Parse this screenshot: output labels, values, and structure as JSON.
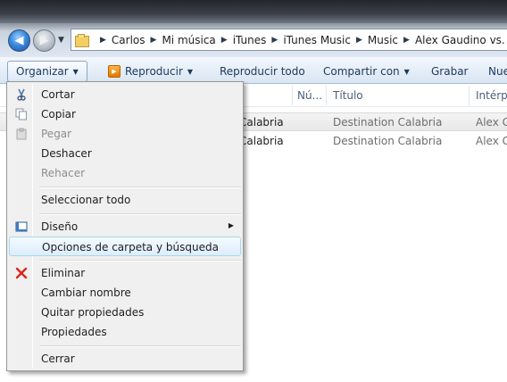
{
  "address": {
    "crumbs": [
      "Carlos",
      "Mi música",
      "iTunes",
      "iTunes Music",
      "Music",
      "Alex Gaudino vs. Crys"
    ]
  },
  "toolbar": {
    "organize": "Organizar",
    "play": "Reproducir",
    "play_all": "Reproducir todo",
    "share": "Compartir con",
    "burn": "Grabar",
    "new": "Nue"
  },
  "columns": {
    "num": "Nú...",
    "title": "Título",
    "artist": "Intérpr"
  },
  "files": [
    {
      "name": "Calabria",
      "title": "Destination Calabria",
      "artist": "Alex Ga"
    },
    {
      "name": "Calabria",
      "title": "Destination Calabria",
      "artist": "Alex Ga"
    }
  ],
  "menu": {
    "cut": "Cortar",
    "copy": "Copiar",
    "paste": "Pegar",
    "undo": "Deshacer",
    "redo": "Rehacer",
    "select_all": "Seleccionar todo",
    "layout": "Diseño",
    "folder_options": "Opciones de carpeta y búsqueda",
    "delete": "Eliminar",
    "rename": "Cambiar nombre",
    "remove_props": "Quitar propiedades",
    "properties": "Propiedades",
    "close": "Cerrar"
  },
  "colors": {
    "accent": "#1e395b",
    "menu_hover": "#dcedfb",
    "delete_icon": "#d9261c"
  }
}
